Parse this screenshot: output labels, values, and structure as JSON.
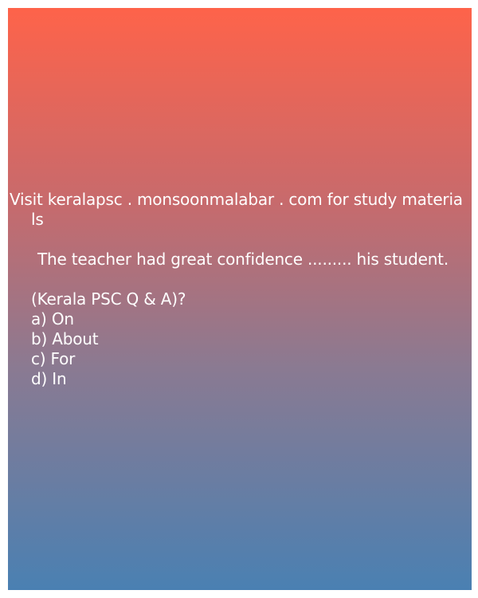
{
  "header": {
    "line1": "Visit keralapsc . monsoonmalabar . com for study materia",
    "line2": "ls"
  },
  "question": {
    "text": "The teacher had great confidence ......... his student.",
    "source": "(Kerala PSC Q & A)?"
  },
  "options": [
    {
      "label": "a) On"
    },
    {
      "label": "b) About"
    },
    {
      "label": "c) For"
    },
    {
      "label": "d) In"
    }
  ]
}
